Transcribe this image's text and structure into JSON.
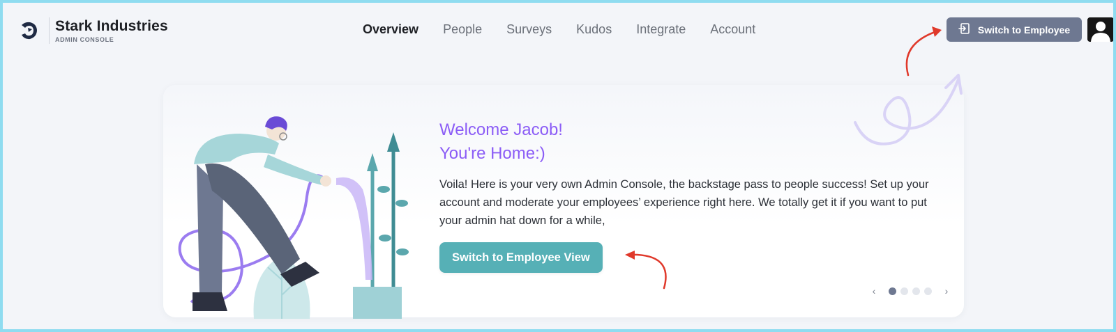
{
  "brand": {
    "name": "Stark Industries",
    "subtitle": "ADMIN CONSOLE"
  },
  "nav": {
    "items": [
      {
        "label": "Overview",
        "active": true
      },
      {
        "label": "People",
        "active": false
      },
      {
        "label": "Surveys",
        "active": false
      },
      {
        "label": "Kudos",
        "active": false
      },
      {
        "label": "Integrate",
        "active": false
      },
      {
        "label": "Account",
        "active": false
      }
    ]
  },
  "header": {
    "switch_button_label": "Switch to Employee",
    "switch_icon": "switch-login-icon",
    "avatar_icon": "user-avatar-icon"
  },
  "hero": {
    "welcome_line1": "Welcome Jacob!",
    "welcome_line2": "You're Home:)",
    "description": "Voila! Here is your very own Admin Console, the backstage pass to people success! Set up your account and moderate your employees’ experience right here. We totally get it if you want to put your admin hat down for a while,",
    "cta_label": "Switch to Employee View"
  },
  "carousel": {
    "prev_icon": "chevron-left-icon",
    "next_icon": "chevron-right-icon",
    "prev_glyph": "‹",
    "next_glyph": "›",
    "dot_count": 4,
    "active_index": 0
  },
  "colors": {
    "accent_purple": "#8b5cf6",
    "teal_button": "#56b0b6",
    "slate_button": "#6e7891",
    "frame_border": "#8fdcf0",
    "annotation_arrow": "#e0392b"
  }
}
